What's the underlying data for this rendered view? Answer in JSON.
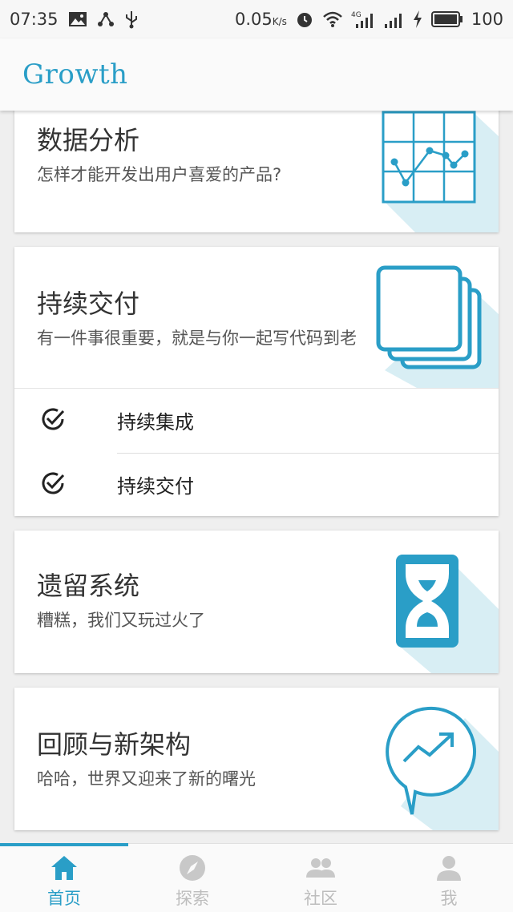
{
  "status_bar": {
    "time": "07:35",
    "speed": "0.05",
    "speed_unit": "K/s",
    "network": "4G",
    "battery": "100"
  },
  "app": {
    "title": "Growth"
  },
  "cards": [
    {
      "title": "数据分析",
      "subtitle": "怎样才能开发出用户喜爱的产品?",
      "icon": "chart-grid-icon"
    },
    {
      "title": "持续交付",
      "subtitle": "有一件事很重要，就是与你一起写代码到老",
      "icon": "stacked-pages-icon",
      "items": [
        {
          "label": "持续集成",
          "icon": "check-circle-icon"
        },
        {
          "label": "持续交付",
          "icon": "check-circle-icon"
        }
      ]
    },
    {
      "title": "遗留系统",
      "subtitle": "糟糕，我们又玩过火了",
      "icon": "hourglass-icon"
    },
    {
      "title": "回顾与新架构",
      "subtitle": "哈哈，世界又迎来了新的曙光",
      "icon": "trend-bubble-icon"
    }
  ],
  "tabs": [
    {
      "label": "首页",
      "icon": "home-icon",
      "active": true
    },
    {
      "label": "探索",
      "icon": "compass-icon",
      "active": false
    },
    {
      "label": "社区",
      "icon": "people-icon",
      "active": false
    },
    {
      "label": "我",
      "icon": "person-icon",
      "active": false
    }
  ],
  "colors": {
    "accent": "#2a9ec7",
    "icon_shadow": "#d8eef4",
    "tab_inactive": "#bdbdbd"
  }
}
